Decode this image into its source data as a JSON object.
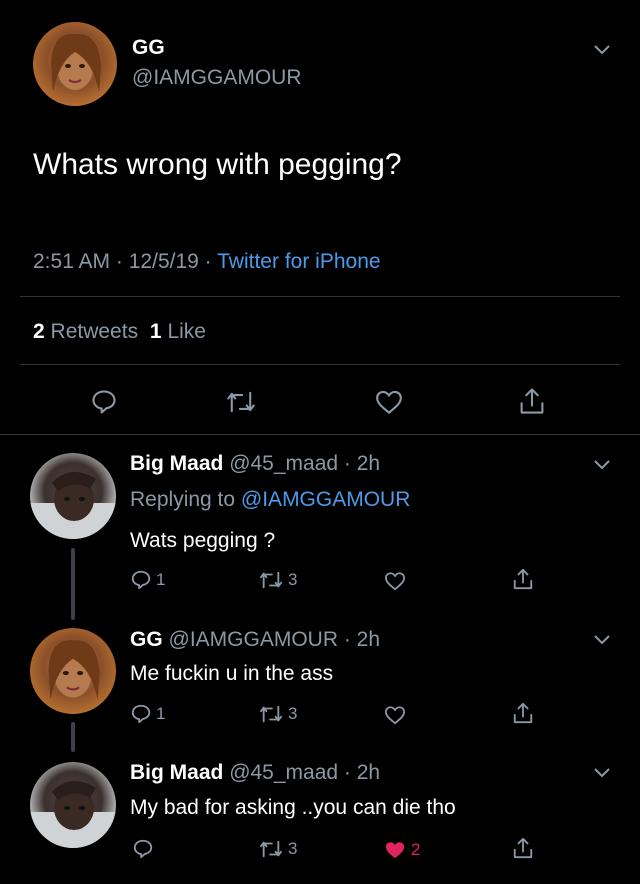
{
  "main_tweet": {
    "display_name": "GG",
    "handle": "@IAMGGAMOUR",
    "text": "Whats wrong with pegging?",
    "time": "2:51 AM",
    "date": "12/5/19",
    "sep": "·",
    "source": "Twitter for iPhone",
    "retweets_count": "2",
    "retweets_label": "Retweets",
    "likes_count": "1",
    "likes_label": "Like"
  },
  "replies": [
    {
      "display_name": "Big Maad",
      "handle": "@45_maad",
      "age": "· 2h",
      "replying_prefix": "Replying to",
      "replying_handle": "@IAMGGAMOUR",
      "text": "Wats pegging ?",
      "reply_count": "1",
      "retweet_count": "3",
      "like_count": ""
    },
    {
      "display_name": "GG",
      "handle": "@IAMGGAMOUR",
      "age": "· 2h",
      "text": "Me fuckin u in the ass",
      "reply_count": "1",
      "retweet_count": "3",
      "like_count": ""
    },
    {
      "display_name": "Big Maad",
      "handle": "@45_maad",
      "age": "· 2h",
      "text": "My bad for asking ..you can die tho",
      "reply_count": "",
      "retweet_count": "3",
      "like_count": "2"
    }
  ],
  "colors": {
    "accent": "#4d9be8",
    "muted": "#8b98a5",
    "liked": "#e0245e"
  },
  "icons": [
    "reply-icon",
    "retweet-icon",
    "like-icon",
    "share-icon",
    "chevron-down-icon"
  ]
}
